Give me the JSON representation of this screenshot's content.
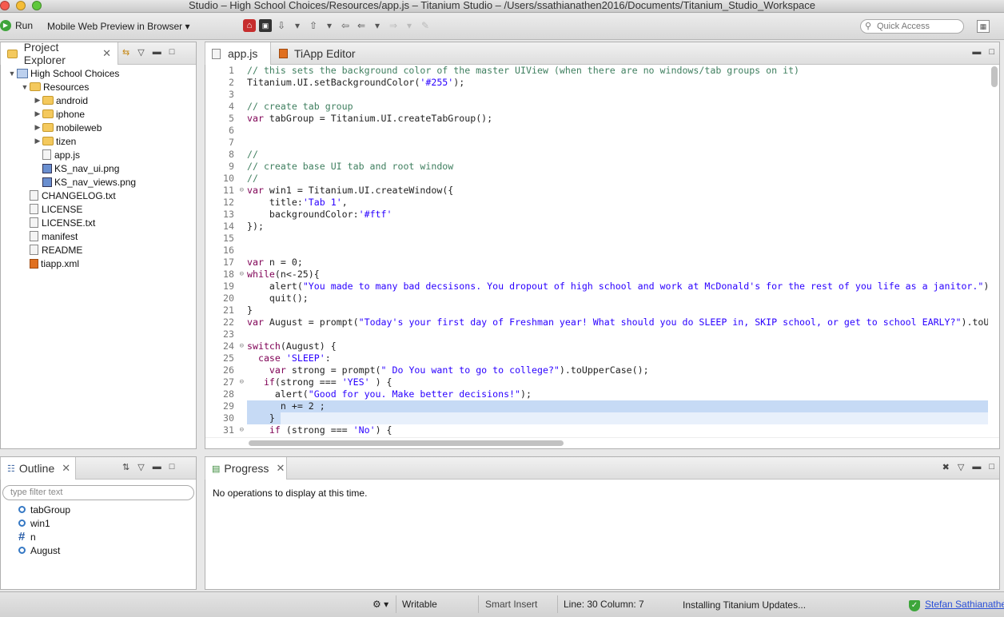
{
  "window": {
    "title": "Studio – High School Choices/Resources/app.js – Titanium Studio – /Users/ssathianathen2016/Documents/Titanium_Studio_Workspace"
  },
  "toolbar": {
    "run_label": "Run",
    "target_label": "Mobile Web Preview in Browser",
    "quick_access_placeholder": "Quick Access"
  },
  "project_explorer": {
    "tab_label": "Project Explorer",
    "items": [
      {
        "label": "High School Choices",
        "icon": "project-icon",
        "twisty": "▼",
        "indent": 0
      },
      {
        "label": "Resources",
        "icon": "folder-icon",
        "twisty": "▼",
        "indent": 1
      },
      {
        "label": "android",
        "icon": "folder-icon",
        "twisty": "▶",
        "indent": 2
      },
      {
        "label": "iphone",
        "icon": "folder-icon",
        "twisty": "▶",
        "indent": 2
      },
      {
        "label": "mobileweb",
        "icon": "folder-icon",
        "twisty": "▶",
        "indent": 2
      },
      {
        "label": "tizen",
        "icon": "folder-icon",
        "twisty": "▶",
        "indent": 2
      },
      {
        "label": "app.js",
        "icon": "file-icon",
        "twisty": "",
        "indent": 2
      },
      {
        "label": "KS_nav_ui.png",
        "icon": "image-icon",
        "twisty": "",
        "indent": 2
      },
      {
        "label": "KS_nav_views.png",
        "icon": "image-icon",
        "twisty": "",
        "indent": 2
      },
      {
        "label": "CHANGELOG.txt",
        "icon": "file-icon",
        "twisty": "",
        "indent": 1
      },
      {
        "label": "LICENSE",
        "icon": "file-icon",
        "twisty": "",
        "indent": 1
      },
      {
        "label": "LICENSE.txt",
        "icon": "file-icon",
        "twisty": "",
        "indent": 1
      },
      {
        "label": "manifest",
        "icon": "file-icon",
        "twisty": "",
        "indent": 1
      },
      {
        "label": "README",
        "icon": "file-icon",
        "twisty": "",
        "indent": 1
      },
      {
        "label": "tiapp.xml",
        "icon": "xml-icon",
        "twisty": "",
        "indent": 1
      }
    ]
  },
  "editor": {
    "tabs": [
      {
        "label": "app.js",
        "active": true
      },
      {
        "label": "TiApp Editor",
        "active": false
      }
    ],
    "lines": [
      {
        "n": "1",
        "fold": "",
        "hl": false,
        "tokens": [
          [
            "cm",
            "// this sets the background color of the master UIView (when there are no windows/tab groups on it)"
          ]
        ]
      },
      {
        "n": "2",
        "fold": "",
        "hl": false,
        "tokens": [
          [
            "",
            "Titanium.UI.setBackgroundColor("
          ],
          [
            "st",
            "'#255'"
          ],
          [
            "",
            ");"
          ]
        ]
      },
      {
        "n": "3",
        "fold": "",
        "hl": false,
        "tokens": []
      },
      {
        "n": "4",
        "fold": "",
        "hl": false,
        "tokens": [
          [
            "cm",
            "// create tab group"
          ]
        ]
      },
      {
        "n": "5",
        "fold": "",
        "hl": false,
        "tokens": [
          [
            "kw",
            "var"
          ],
          [
            "",
            " tabGroup = Titanium.UI.createTabGroup();"
          ]
        ]
      },
      {
        "n": "6",
        "fold": "",
        "hl": false,
        "tokens": []
      },
      {
        "n": "7",
        "fold": "",
        "hl": false,
        "tokens": []
      },
      {
        "n": "8",
        "fold": "",
        "hl": false,
        "tokens": [
          [
            "cm",
            "//"
          ]
        ]
      },
      {
        "n": "9",
        "fold": "",
        "hl": false,
        "tokens": [
          [
            "cm",
            "// create base UI tab and root window"
          ]
        ]
      },
      {
        "n": "10",
        "fold": "",
        "hl": false,
        "tokens": [
          [
            "cm",
            "//"
          ]
        ]
      },
      {
        "n": "11",
        "fold": "⊖",
        "hl": false,
        "tokens": [
          [
            "kw",
            "var"
          ],
          [
            "",
            " win1 = Titanium.UI.createWindow({"
          ]
        ]
      },
      {
        "n": "12",
        "fold": "",
        "hl": false,
        "tokens": [
          [
            "",
            "    title:"
          ],
          [
            "st",
            "'Tab 1'"
          ],
          [
            "",
            ","
          ]
        ]
      },
      {
        "n": "13",
        "fold": "",
        "hl": false,
        "tokens": [
          [
            "",
            "    backgroundColor:"
          ],
          [
            "st",
            "'#ftf'"
          ]
        ]
      },
      {
        "n": "14",
        "fold": "",
        "hl": false,
        "tokens": [
          [
            "",
            "});"
          ]
        ]
      },
      {
        "n": "15",
        "fold": "",
        "hl": false,
        "tokens": []
      },
      {
        "n": "16",
        "fold": "",
        "hl": false,
        "tokens": []
      },
      {
        "n": "17",
        "fold": "",
        "hl": false,
        "tokens": [
          [
            "kw",
            "var"
          ],
          [
            "",
            " n = 0;"
          ]
        ]
      },
      {
        "n": "18",
        "fold": "⊖",
        "hl": false,
        "tokens": [
          [
            "kw",
            "while"
          ],
          [
            "",
            "(n<-25){"
          ]
        ]
      },
      {
        "n": "19",
        "fold": "",
        "hl": false,
        "tokens": [
          [
            "",
            "    alert("
          ],
          [
            "st",
            "\"You made to many bad decsisons. You dropout of high school and work at McDonald's for the rest of you life as a janitor.\""
          ],
          [
            "",
            ");"
          ]
        ]
      },
      {
        "n": "20",
        "fold": "",
        "hl": false,
        "tokens": [
          [
            "",
            "    quit();"
          ]
        ]
      },
      {
        "n": "21",
        "fold": "",
        "hl": false,
        "tokens": [
          [
            "",
            "}"
          ]
        ]
      },
      {
        "n": "22",
        "fold": "",
        "hl": false,
        "tokens": [
          [
            "kw",
            "var"
          ],
          [
            "",
            " August = prompt("
          ],
          [
            "st",
            "\"Today's your first day of Freshman year! What should you do SLEEP in, SKIP school, or get to school EARLY?\""
          ],
          [
            "",
            ").toUpperCase();"
          ]
        ]
      },
      {
        "n": "23",
        "fold": "",
        "hl": false,
        "tokens": []
      },
      {
        "n": "24",
        "fold": "⊖",
        "hl": false,
        "tokens": [
          [
            "kw",
            "switch"
          ],
          [
            "",
            "(August) {"
          ]
        ]
      },
      {
        "n": "25",
        "fold": "",
        "hl": false,
        "tokens": [
          [
            "",
            "  "
          ],
          [
            "kw",
            "case"
          ],
          [
            "",
            " "
          ],
          [
            "st",
            "'SLEEP'"
          ],
          [
            "",
            ":"
          ]
        ]
      },
      {
        "n": "26",
        "fold": "",
        "hl": false,
        "tokens": [
          [
            "",
            "    "
          ],
          [
            "kw",
            "var"
          ],
          [
            "",
            " strong = prompt("
          ],
          [
            "st",
            "\" Do You want to go to college?\""
          ],
          [
            "",
            ").toUpperCase();"
          ]
        ]
      },
      {
        "n": "27",
        "fold": "⊖",
        "hl": false,
        "tokens": [
          [
            "",
            "   "
          ],
          [
            "kw",
            "if"
          ],
          [
            "",
            "(strong === "
          ],
          [
            "st",
            "'YES'"
          ],
          [
            "",
            " ) {"
          ]
        ]
      },
      {
        "n": "28",
        "fold": "",
        "hl": false,
        "tokens": [
          [
            "",
            "     alert("
          ],
          [
            "st",
            "\"Good for you. Make better decisions!\""
          ],
          [
            "",
            ");"
          ]
        ]
      },
      {
        "n": "29",
        "fold": "",
        "hl": true,
        "tokens": [
          [
            "",
            "      n += 2 ;"
          ]
        ]
      },
      {
        "n": "30",
        "fold": "",
        "hl": true,
        "tokens": [
          [
            "",
            "    }"
          ]
        ]
      },
      {
        "n": "31",
        "fold": "⊖",
        "hl": false,
        "tokens": [
          [
            "",
            "    "
          ],
          [
            "kw",
            "if"
          ],
          [
            "",
            " (strong === "
          ],
          [
            "st",
            "'No'"
          ],
          [
            "",
            ") {"
          ]
        ]
      }
    ]
  },
  "outline": {
    "tab_label": "Outline",
    "filter_placeholder": "type filter text",
    "items": [
      {
        "label": "tabGroup",
        "icon": "variable-icon"
      },
      {
        "label": "win1",
        "icon": "variable-icon"
      },
      {
        "label": "n",
        "icon": "number-icon"
      },
      {
        "label": "August",
        "icon": "variable-icon"
      }
    ]
  },
  "progress": {
    "tab_label": "Progress",
    "message": "No operations to display at this time."
  },
  "statusbar": {
    "writable": "Writable",
    "insert_mode": "Smart Insert",
    "position": "Line: 30 Column: 7",
    "updates": "Installing Titanium Updates...",
    "user": "Stefan Sathianathen"
  }
}
